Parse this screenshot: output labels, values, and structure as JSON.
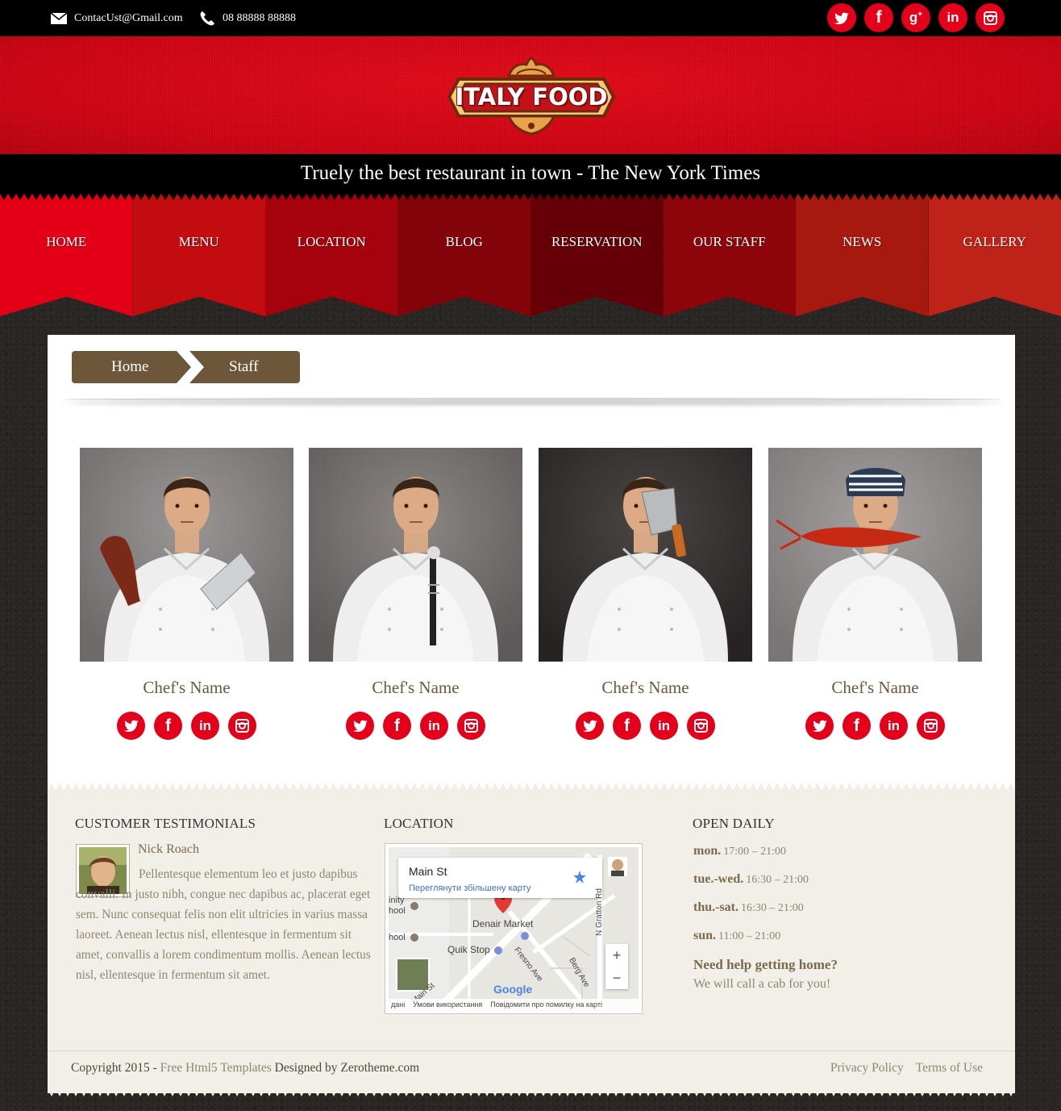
{
  "topbar": {
    "email": "ContacUst@Gmail.com",
    "phone": "08 88888 88888",
    "social": [
      {
        "icon": "twitter-icon",
        "glyph": "t"
      },
      {
        "icon": "facebook-icon",
        "glyph": "f"
      },
      {
        "icon": "google-plus-icon",
        "glyph": "g+"
      },
      {
        "icon": "linkedin-icon",
        "glyph": "in"
      },
      {
        "icon": "instagram-icon",
        "glyph": "ig"
      }
    ]
  },
  "header": {
    "logo_text": "ITALY FOOD",
    "tagline": "Truely the best restaurant in town - The New York Times"
  },
  "nav": {
    "items": [
      {
        "label": "HOME",
        "color": "#e30016"
      },
      {
        "label": "MENU",
        "color": "#c20c10"
      },
      {
        "label": "LOCATION",
        "color": "#a6020b"
      },
      {
        "label": "BLOG",
        "color": "#83030a"
      },
      {
        "label": "RESERVATION",
        "color": "#650106"
      },
      {
        "label": "OUR STAFF",
        "color": "#8d040b"
      },
      {
        "label": "NEWS",
        "color": "#a7190e"
      },
      {
        "label": "GALLERY",
        "color": "#bf2216"
      }
    ]
  },
  "breadcrumb": {
    "home": "Home",
    "current": "Staff"
  },
  "staff": [
    {
      "name": "Chef's Name"
    },
    {
      "name": "Chef's Name"
    },
    {
      "name": "Chef's Name"
    },
    {
      "name": "Chef's Name"
    }
  ],
  "footer": {
    "testimonials": {
      "heading": "CUSTOMER TESTIMONIALS",
      "name": "Nick Roach",
      "text": "Pellentesque elementum leo et justo dapibus convalli. In justo nibh, congue nec dapibus ac, placerat eget sem. Nunc consequat felis non elit ultricies in varius massa laoreet. Aenean lectus nisl, ellentesque in fermentum sit amet, convallis a lorem condimentum mollis. Aenean lectus nisl, ellentesque in fermentum sit amet."
    },
    "location": {
      "heading": "LOCATION",
      "map_title": "Main St",
      "map_link": "Переглянути збільшену карту",
      "labels": {
        "denair": "Denair Market",
        "quik": "Quik Stop",
        "fresno": "Fresno Ave",
        "berg": "Berg Ave",
        "gratton": "N Gratton Rd",
        "main": "Main St",
        "school1": "inity\nhool",
        "school2": "hool",
        "google": "Google"
      },
      "map_footer": [
        "дані",
        "Умови використання",
        "Повідомити про помилку на карті"
      ]
    },
    "hours": {
      "heading": "OPEN DAILY",
      "rows": [
        {
          "day": "mon.",
          "time": "17:00 – 21:00"
        },
        {
          "day": "tue.-wed.",
          "time": "16:30 – 21:00"
        },
        {
          "day": "thu.-sat.",
          "time": "16:30 – 21:00"
        },
        {
          "day": "sun.",
          "time": "11:00 – 21:00"
        }
      ],
      "help_q": "Need help getting home?",
      "help_a": "We will call a cab for you!"
    },
    "copyright_prefix": "Copyright 2015 - ",
    "copyright_link": "Free Html5 Templates",
    "copyright_suffix": " Designed by Zerotheme.com",
    "links": [
      "Privacy Policy",
      "Terms of Use"
    ]
  },
  "colors": {
    "accent_red": "#e4001a",
    "brown": "#6d573a",
    "footer_bg": "#f1efe7"
  }
}
